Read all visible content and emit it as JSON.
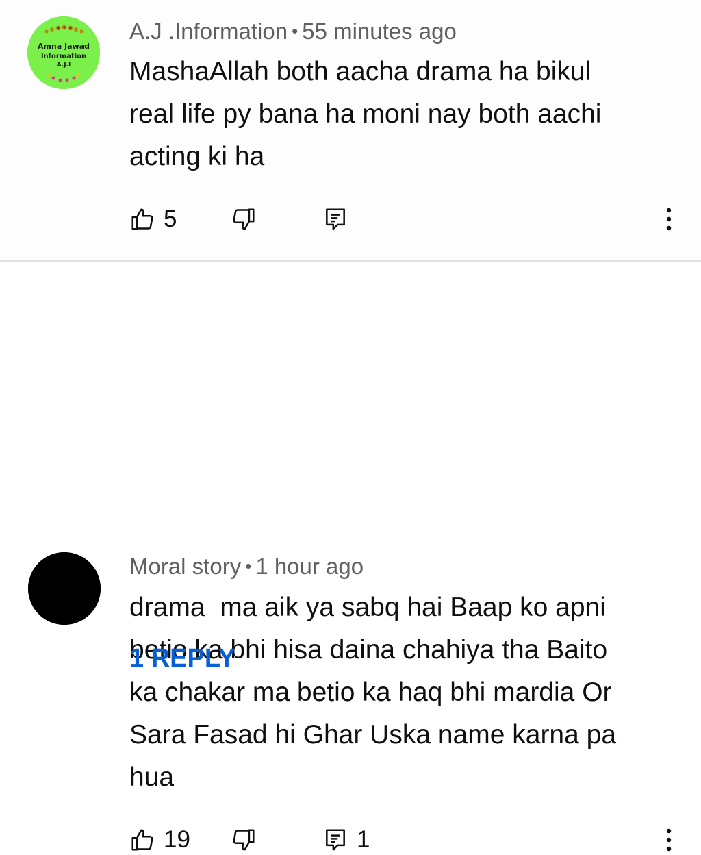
{
  "comments": [
    {
      "author": "A.J .Information",
      "separator": "•",
      "time": "55 minutes ago",
      "text": "MashaAllah both aacha drama ha bikul\nreal life py bana ha moni nay both aachi\nacting ki ha",
      "likes": "5",
      "replies_count": "",
      "avatar": {
        "icon": "channel-logo-icon",
        "line1": "Amna Jawad",
        "line2": "Information",
        "line3": "A.J.I",
        "bg_color": "#7cf04a"
      }
    },
    {
      "author": "Moral story",
      "separator": "•",
      "time": "1 hour ago",
      "text": "drama  ma aik ya sabq hai Baap ko apni\nbetio ka bhi hisa daina chahiya tha Baito\nka chakar ma betio ka haq bhi mardia Or\nSara Fasad hi Ghar Uska name karna pa\nhua",
      "likes": "19",
      "replies_count": "1",
      "avatar": {
        "icon": "black-circle-avatar",
        "bg_color": "#000000"
      }
    }
  ],
  "replies_link": "1 REPLY",
  "colors": {
    "link": "#065fd4",
    "meta_text": "#606060",
    "body_text": "#0f0f0f"
  }
}
